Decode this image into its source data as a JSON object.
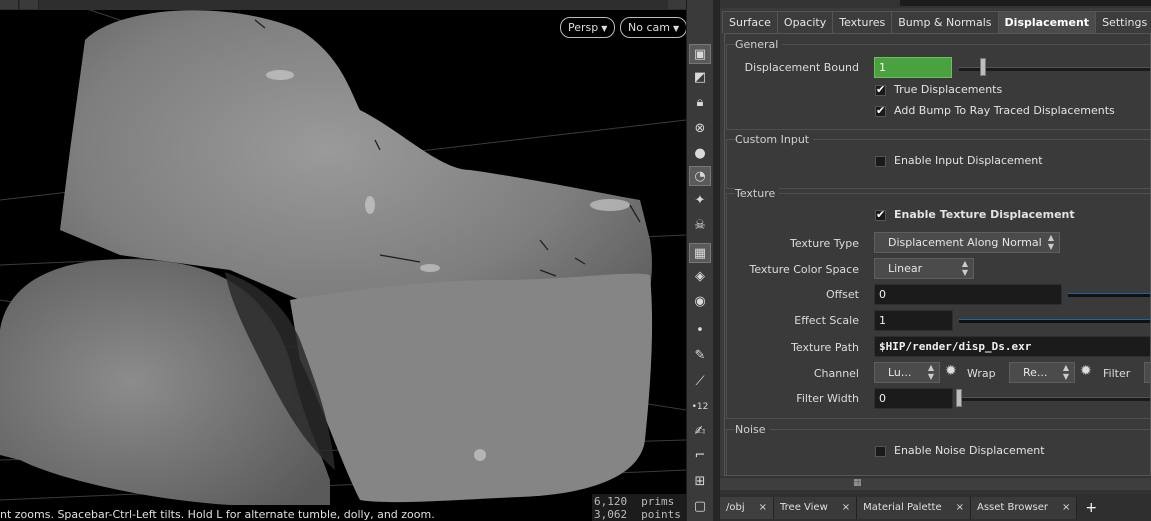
{
  "viewport": {
    "camera_mode": "Persp",
    "camera": "No cam",
    "status_text": "nt zooms. Spacebar-Ctrl-Left tilts. Hold L for alternate tumble, dolly, and zoom.",
    "stats": [
      {
        "value": "6,120",
        "unit": "prims"
      },
      {
        "value": "3,062",
        "unit": "points"
      }
    ]
  },
  "toolbar": {
    "icons": [
      "view-display-icon",
      "geometry-view-icon",
      "lock-icon",
      "x-ray-icon",
      "shading-sphere-icon",
      "light-bulb-icon",
      "light-icon",
      "skull-icon",
      "display-options-icon",
      "camera-eye-icon",
      "snapshot-eye-icon",
      "dot-icon",
      "pen-icon",
      "pin-icon",
      "vertex-12-icon",
      "brush-icon",
      "curve-corner-icon",
      "grid-icon"
    ]
  },
  "tabs": [
    "Surface",
    "Opacity",
    "Textures",
    "Bump & Normals",
    "Displacement",
    "Settings"
  ],
  "active_tab": "Displacement",
  "general": {
    "title": "General",
    "displacement_bound_label": "Displacement Bound",
    "displacement_bound_value": "1",
    "displacement_bound_slider": 0.12,
    "true_displacements": "True Displacements",
    "add_bump": "Add Bump To Ray Traced Displacements"
  },
  "custom_input": {
    "title": "Custom Input",
    "enable_input": "Enable Input Displacement"
  },
  "texture": {
    "title": "Texture",
    "enable_texture": "Enable Texture Displacement",
    "texture_type_label": "Texture Type",
    "texture_type_value": "Displacement Along Normal",
    "color_space_label": "Texture Color Space",
    "color_space_value": "Linear",
    "offset_label": "Offset",
    "offset_value": "0",
    "effect_scale_label": "Effect Scale",
    "effect_scale_value": "1",
    "texture_path_label": "Texture Path",
    "texture_path_value": "$HIP/render/disp_Ds.exr",
    "channel_label": "Channel",
    "channel_value": "Lu...",
    "wrap_label": "Wrap",
    "wrap_value": "Re...",
    "filter_label": "Filter",
    "filter_width_label": "Filter Width",
    "filter_width_value": "0"
  },
  "noise": {
    "title": "Noise",
    "enable_noise": "Enable Noise Displacement"
  },
  "bottom_tabs": [
    "/obj",
    "Tree View",
    "Material Palette",
    "Asset Browser"
  ],
  "colors": {
    "viewport_bg": "#000000",
    "panel_bg": "#3a3a3a",
    "green_field": "#4aa13f",
    "slider_blue": "#1d63a8"
  }
}
